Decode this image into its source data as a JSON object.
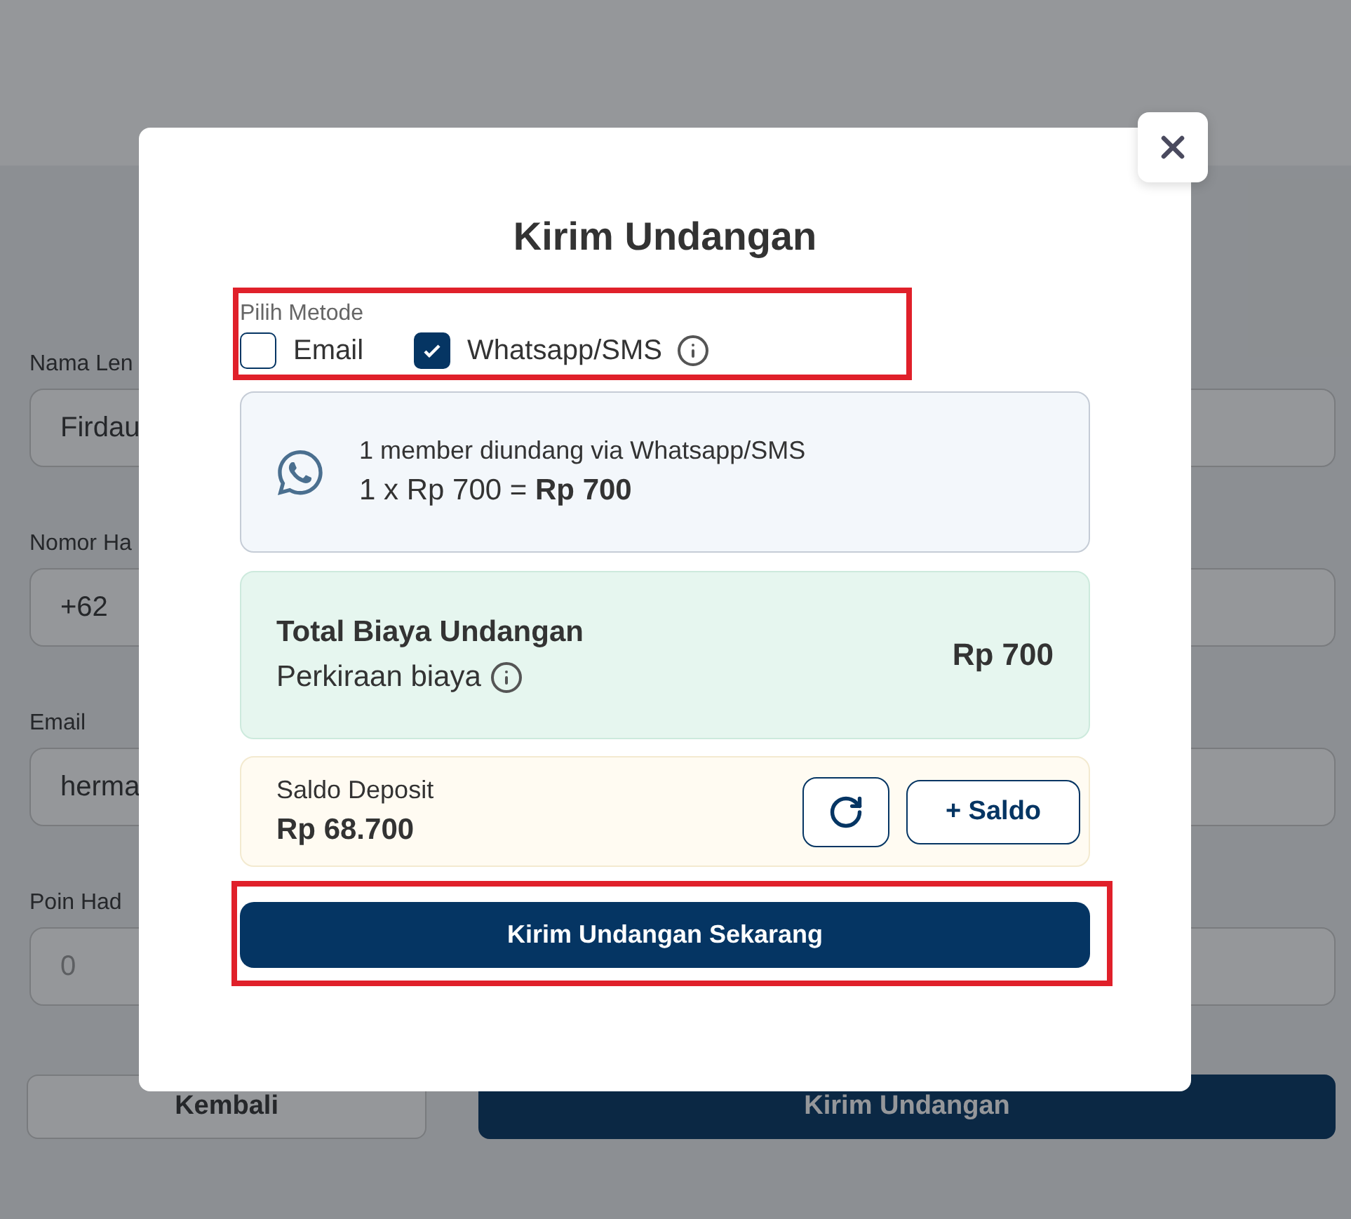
{
  "background_form": {
    "fields": [
      {
        "label": "Nama Len",
        "value": "Firdau"
      },
      {
        "label": "Nomor Ha",
        "value": "+62"
      },
      {
        "label": "Email",
        "value": "herma"
      },
      {
        "label": "Poin Had",
        "placeholder": "0"
      }
    ],
    "buttons": [
      {
        "label": "Kembali",
        "kind": "secondary"
      },
      {
        "label": "Kirim Undangan",
        "kind": "primary"
      }
    ]
  },
  "dialog": {
    "title": "Kirim Undangan",
    "method": {
      "label": "Pilih Metode",
      "highlighted": true,
      "options": [
        {
          "label": "Email",
          "checked": false,
          "info": false
        },
        {
          "label": "Whatsapp/SMS",
          "checked": true,
          "info": true
        }
      ]
    },
    "summary": {
      "line": "1 member diundang via Whatsapp/SMS",
      "calc": "1 x Rp 700 = **Rp 700**"
    },
    "total": {
      "title": "Total Biaya Undangan",
      "subtitle": "Perkiraan biaya",
      "amount": "Rp 700"
    },
    "deposit": {
      "label": "Saldo Deposit",
      "amount": "Rp 68.700",
      "button": "+ Saldo"
    },
    "submit": {
      "label": "Kirim Undangan Sekarang",
      "highlighted": true
    }
  }
}
